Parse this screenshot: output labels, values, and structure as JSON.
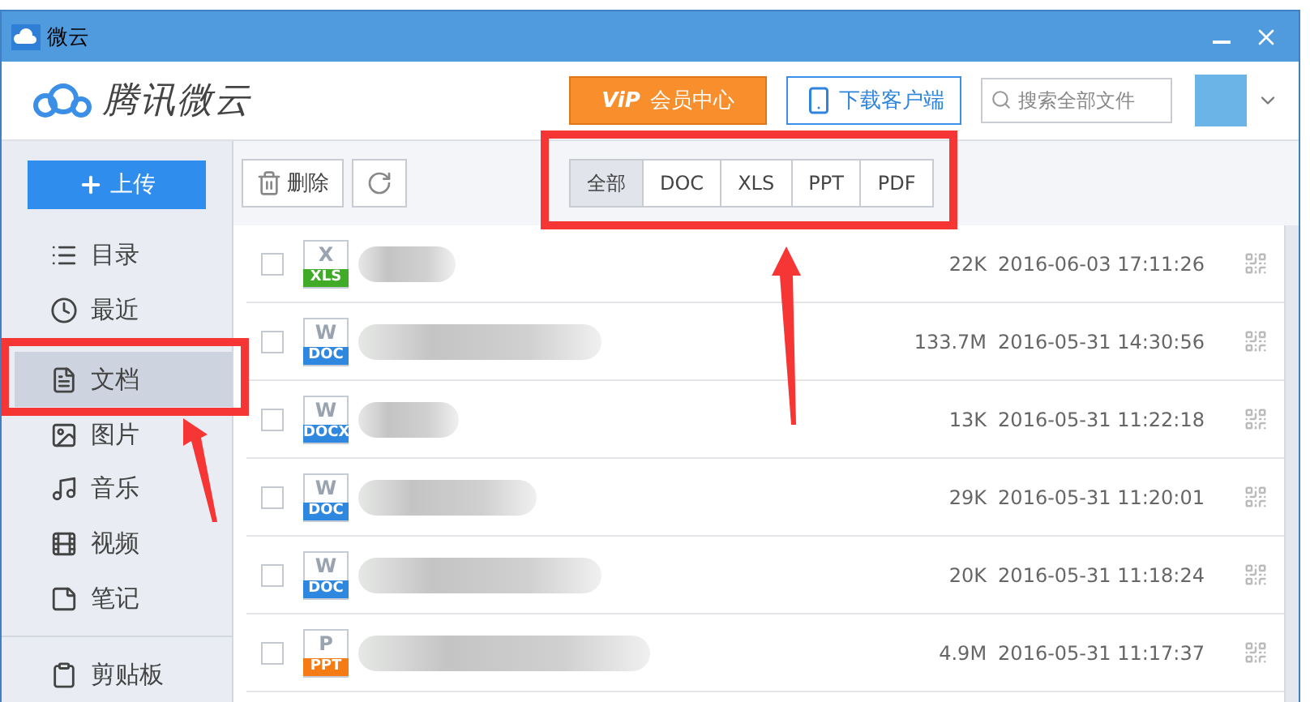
{
  "window": {
    "title": "微云"
  },
  "header": {
    "logo_text": "腾讯微云",
    "vip_badge": "ViP",
    "vip_button": "会员中心",
    "download_button": "下载客户端",
    "search": {
      "placeholder": "搜索全部文件"
    }
  },
  "sidebar": {
    "upload_button": "上传",
    "items": [
      {
        "label": "目录",
        "kind": "list",
        "selected": false
      },
      {
        "label": "最近",
        "kind": "clock",
        "selected": false
      },
      {
        "label": "文档",
        "kind": "doc",
        "selected": true
      },
      {
        "label": "图片",
        "kind": "image",
        "selected": false
      },
      {
        "label": "音乐",
        "kind": "music",
        "selected": false
      },
      {
        "label": "视频",
        "kind": "film",
        "selected": false
      },
      {
        "label": "笔记",
        "kind": "note",
        "selected": false
      }
    ],
    "bottom_items": [
      {
        "label": "剪贴板",
        "kind": "clipboard",
        "selected": false
      }
    ]
  },
  "toolbar": {
    "delete_button": "删除",
    "filters": [
      {
        "label": "全部",
        "selected": true
      },
      {
        "label": "DOC",
        "selected": false
      },
      {
        "label": "XLS",
        "selected": false
      },
      {
        "label": "PPT",
        "selected": false
      },
      {
        "label": "PDF",
        "selected": false
      }
    ]
  },
  "files": [
    {
      "letter": "X",
      "type": "XLS",
      "kind": "sheet",
      "checked": false,
      "size": "22K",
      "date": "2016-06-03 17:11:26"
    },
    {
      "letter": "W",
      "type": "DOC",
      "kind": "word",
      "checked": false,
      "size": "133.7M",
      "date": "2016-05-31 14:30:56"
    },
    {
      "letter": "W",
      "type": "DOCX",
      "kind": "word",
      "checked": false,
      "size": "13K",
      "date": "2016-05-31 11:22:18"
    },
    {
      "letter": "W",
      "type": "DOC",
      "kind": "word",
      "checked": false,
      "size": "29K",
      "date": "2016-05-31 11:20:01"
    },
    {
      "letter": "W",
      "type": "DOC",
      "kind": "word",
      "checked": false,
      "size": "20K",
      "date": "2016-05-31 11:18:24"
    },
    {
      "letter": "P",
      "type": "PPT",
      "kind": "slides",
      "checked": false,
      "size": "4.9M",
      "date": "2016-05-31 11:17:37"
    }
  ]
}
